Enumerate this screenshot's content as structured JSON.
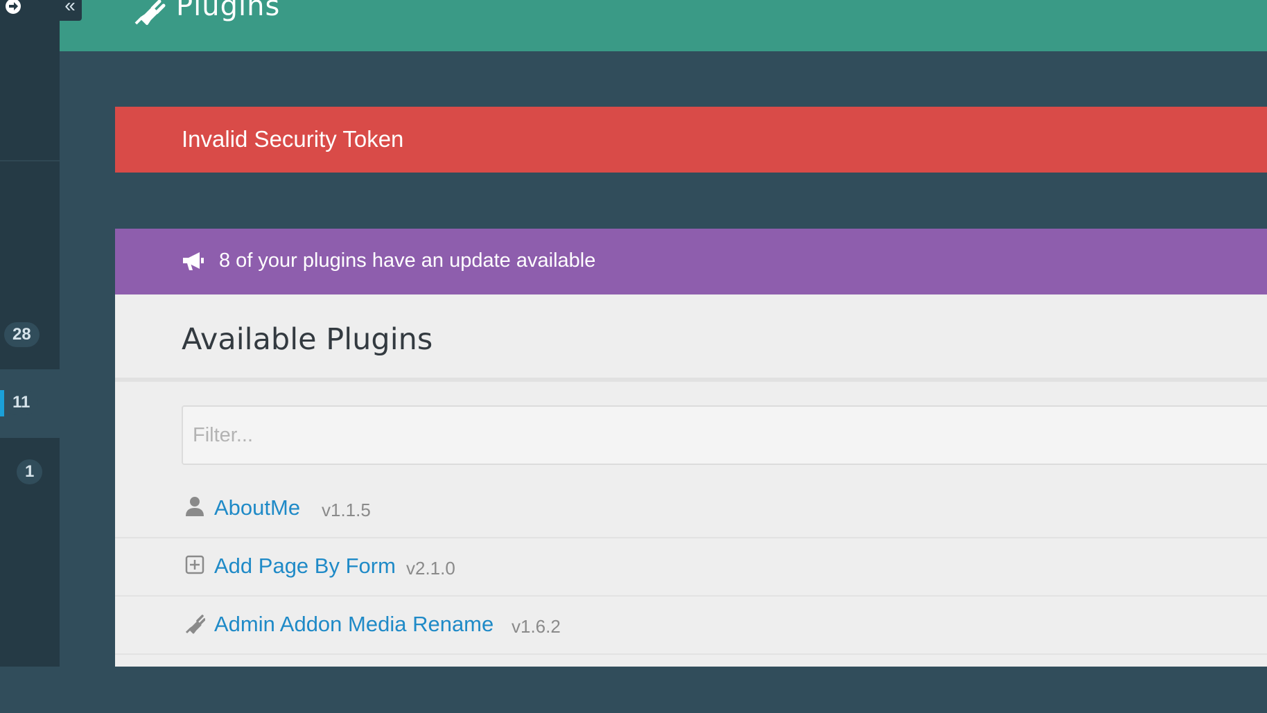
{
  "header": {
    "title": "Plugins",
    "icon": "plug-icon"
  },
  "sidebar": {
    "badges": [
      "28",
      "11",
      "1"
    ],
    "active_index": 1,
    "collapse_label": "«",
    "logout_icon": "sign-out-icon"
  },
  "alerts": {
    "error": "Invalid Security Token",
    "notice": "8 of your plugins have an update available",
    "notice_icon": "bullhorn-icon"
  },
  "panel": {
    "title": "Available Plugins",
    "filter_placeholder": "Filter...",
    "plugins": [
      {
        "name": "AboutMe",
        "version": "v1.1.5",
        "icon": "user-icon"
      },
      {
        "name": "Add Page By Form",
        "version": "v2.1.0",
        "icon": "plus-square-icon"
      },
      {
        "name": "Admin Addon Media Rename",
        "version": "v1.6.2",
        "icon": "plug-icon"
      }
    ]
  },
  "colors": {
    "header": "#3a9a86",
    "error": "#d94b48",
    "notice": "#8e5ead",
    "link": "#1f8ac7",
    "background": "#314d5b",
    "sidebar": "#253a45"
  }
}
